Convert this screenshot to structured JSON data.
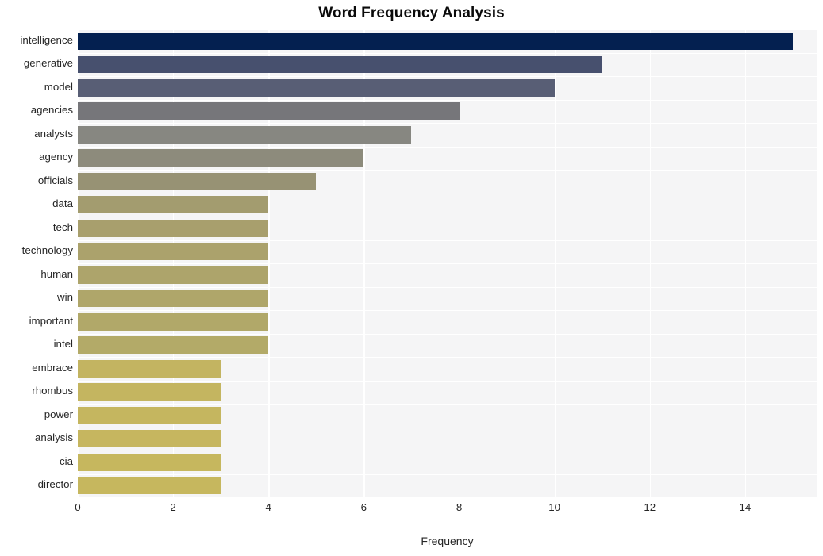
{
  "chart_data": {
    "type": "bar",
    "orientation": "horizontal",
    "title": "Word Frequency Analysis",
    "xlabel": "Frequency",
    "ylabel": "",
    "xlim": [
      0,
      15.5
    ],
    "xticks": [
      0,
      2,
      4,
      6,
      8,
      10,
      12,
      14
    ],
    "grid": true,
    "legend": null,
    "categories": [
      "intelligence",
      "generative",
      "model",
      "agencies",
      "analysts",
      "agency",
      "officials",
      "data",
      "tech",
      "technology",
      "human",
      "win",
      "important",
      "intel",
      "embrace",
      "rhombus",
      "power",
      "analysis",
      "cia",
      "director"
    ],
    "values": [
      15,
      11,
      10,
      8,
      7,
      6,
      5,
      4,
      4,
      4,
      4,
      4,
      4,
      4,
      3,
      3,
      3,
      3,
      3,
      3
    ],
    "bar_colors": [
      "#042050",
      "#47506e",
      "#585e75",
      "#76767a",
      "#878781",
      "#8d8b7c",
      "#979274",
      "#a39c6f",
      "#a89f6d",
      "#aba26c",
      "#ada46b",
      "#afa66a",
      "#b1a869",
      "#b3aa68",
      "#c3b461",
      "#c4b560",
      "#c5b65f",
      "#c6b65f",
      "#c6b75e",
      "#c6b75e"
    ],
    "style": {
      "plot_background": "#f5f5f6",
      "figure_background": "#ffffff",
      "gridline_color": "#ffffff",
      "text_color": "#262626",
      "title_color": "#0a0a0a"
    }
  }
}
